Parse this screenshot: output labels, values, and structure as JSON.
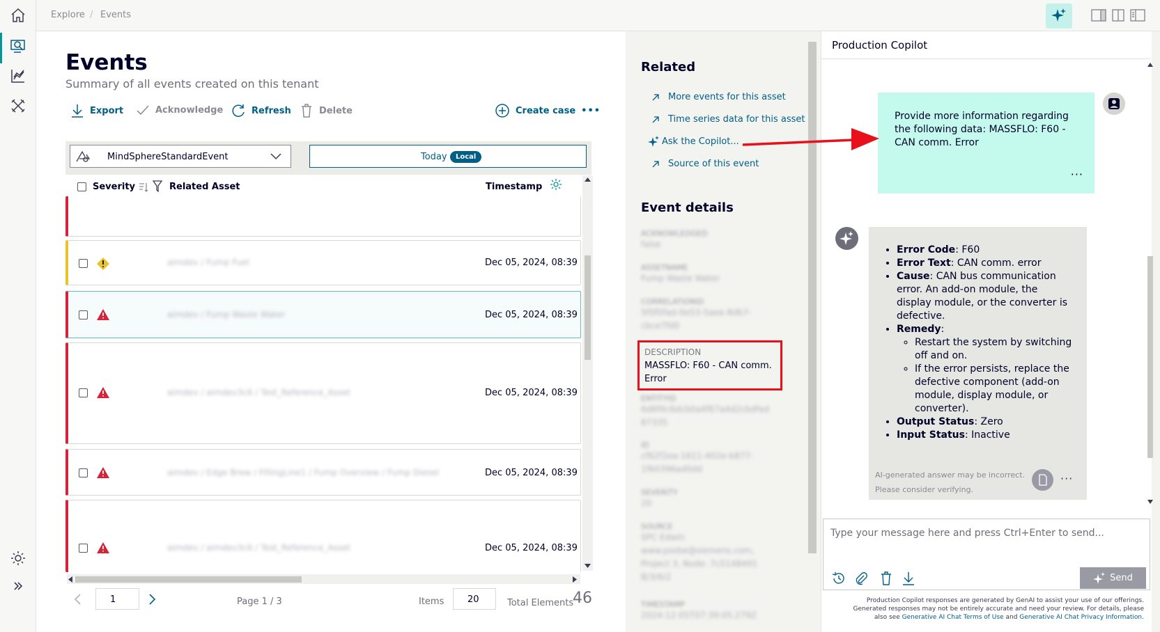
{
  "nav": {
    "items": [
      "home-icon",
      "explore-icon",
      "chart-icon",
      "tools-icon"
    ],
    "bottom": [
      "settings-icon",
      "expand-icon"
    ]
  },
  "breadcrumb": {
    "first": "Explore",
    "sep": "/",
    "second": "Events"
  },
  "events": {
    "title": "Events",
    "subtitle": "Summary of all events created on this tenant",
    "toolbar": {
      "export": "Export",
      "acknowledge": "Acknowledge",
      "refresh": "Refresh",
      "delete": "Delete",
      "create_case": "Create case",
      "more": "•••"
    },
    "filter": {
      "event_type": "MindSphereStandardEvent",
      "date_label": "Today",
      "date_badge": "Local"
    },
    "columns": {
      "severity": "Severity",
      "related_asset": "Related Asset",
      "timestamp": "Timestamp"
    },
    "rows": [
      {
        "severity": "error",
        "asset": "",
        "timestamp": ""
      },
      {
        "severity": "warning",
        "asset": "aimdev / Fump Fuel",
        "timestamp": "Dec 05, 2024, 08:39"
      },
      {
        "severity": "error",
        "asset": "aimdev / Fump Waste Water",
        "timestamp": "Dec 05, 2024, 08:39"
      },
      {
        "severity": "error",
        "asset": "aimdev / aimdev3c6 / Test_Reference_Asset",
        "timestamp": "Dec 05, 2024, 08:39"
      },
      {
        "severity": "error",
        "asset": "aimdev / Edge Brew / FillingLine1 / Fump Overview / Fump Diesel",
        "timestamp": "Dec 05, 2024, 08:39"
      },
      {
        "severity": "error",
        "asset": "aimdev / aimdev3c6 / Test_Reference_Asset",
        "timestamp": "Dec 05, 2024, 08:39"
      }
    ],
    "pagination": {
      "page_input": "1",
      "page_text": "Page 1 / 3",
      "items_label": "Items",
      "items_value": "20",
      "total_label": "Total Elements",
      "total_value": "46"
    }
  },
  "related": {
    "heading": "Related",
    "links": [
      "More events for this asset",
      "Time series data for this asset",
      "Ask the Copilot...",
      "Source of this event"
    ]
  },
  "event_details": {
    "heading": "Event details",
    "fields": [
      {
        "label": "ACKNOWLEDGED",
        "value": "false"
      },
      {
        "label": "ASSETNAME",
        "value": "Fump Waste Water"
      },
      {
        "label": "CORRELATIONID",
        "value": "5f0f0fad-0e53-5aee-8db7-cbce7fd0"
      },
      {
        "label": "DESCRIPTION",
        "value": "MASSFLO: F60 - CAN comm. Error"
      },
      {
        "label": "ENTITYID",
        "value": "6d6f0c6dcb0a4f67a4d2cbdfad 87335"
      },
      {
        "label": "ID",
        "value": "cf62f2ea-1611-402e-b877-1f60396ad0dd"
      },
      {
        "label": "SEVERITY",
        "value": "20"
      },
      {
        "label": "SOURCE",
        "value": "SPC Edwin www.pssbe@siemens.com, Project 3, Node: 7c5148491 B/3/6/2"
      },
      {
        "label": "TIMESTAMP",
        "value": "2024-12-05T07:39:05.279Z"
      }
    ]
  },
  "copilot": {
    "title": "Production Copilot",
    "user_message": "Provide more information regarding the following data: MASSFLO: F60 - CAN comm. Error",
    "more": "···",
    "answer": {
      "error_code_label": "Error Code",
      "error_code": ": F60",
      "error_text_label": "Error Text",
      "error_text": ": CAN comm. error",
      "cause_label": "Cause",
      "cause": ": CAN bus communication error. An add-on module, the display module, or the converter is defective.",
      "remedy_label": "Remedy",
      "remedy_colon": ":",
      "remedy_1": "Restart the system by switching off and on.",
      "remedy_2": "If the error persists, replace the defective component (add-on module, display module, or converter).",
      "output_label": "Output Status",
      "output": ": Zero",
      "input_label": "Input Status",
      "input": ": Inactive"
    },
    "disclaimer_1": "AI-generated answer may be incorrect.",
    "disclaimer_2": "Please consider verifying.",
    "composer_placeholder": "Type your message here and press Ctrl+Enter to send...",
    "send": "Send",
    "footer_1": "Production Copilot responses are generated by GenAI to assist your use of our offerings.",
    "footer_2": "Generated responses may not be entirely accurate and need your review. For details, please",
    "footer_3": "also see",
    "footer_link_1": "Generative AI Chat Terms of Use",
    "footer_and": "and",
    "footer_link_2": "Generative AI Chat Privacy Information."
  },
  "colors": {
    "accent": "#005f87",
    "teal": "#009999",
    "error": "#d72339",
    "warning": "#e9c32a",
    "highlight": "#e8101a",
    "user_bubble": "#c4f9ee"
  }
}
